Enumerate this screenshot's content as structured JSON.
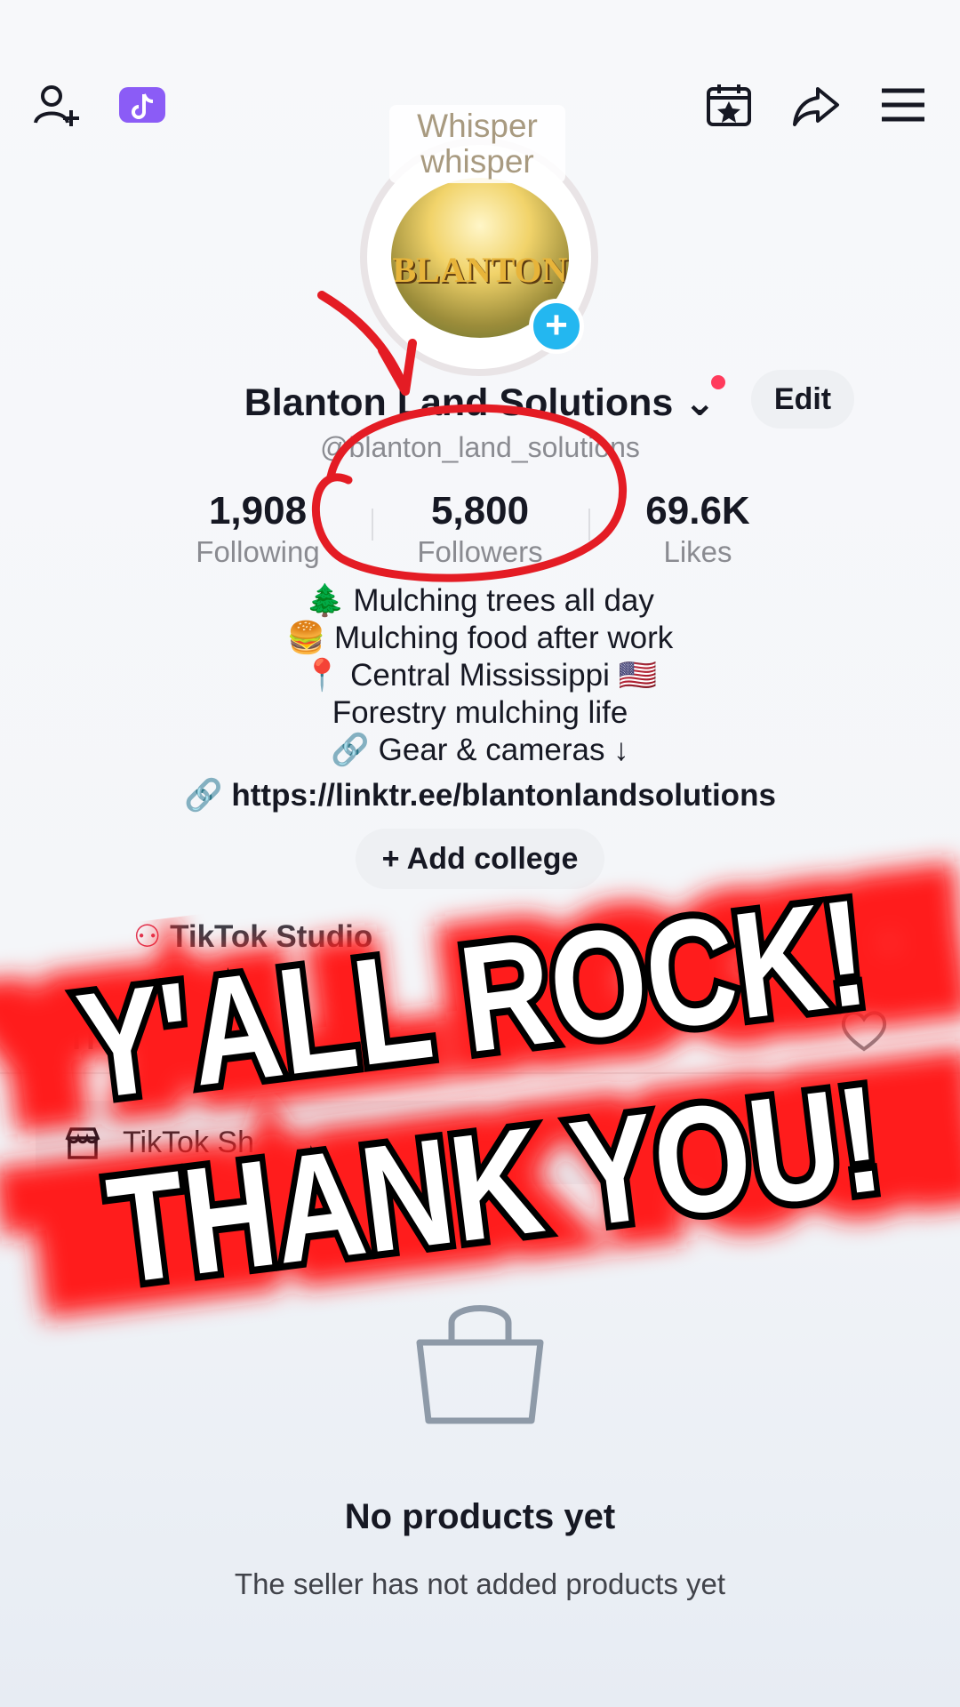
{
  "header": {
    "add_friend_icon": "person-plus",
    "app_badge_icon": "tiktok-purple-badge",
    "calendar_icon": "calendar-star",
    "share_icon": "share-arrow",
    "menu_icon": "hamburger"
  },
  "profile": {
    "note_text": "Whisper whisper",
    "logo_text": "BLANTON",
    "name": "Blanton Land Solutions",
    "edit_label": "Edit",
    "handle": "@blanton_land_solutions",
    "stats": [
      {
        "value": "1,908",
        "label": "Following"
      },
      {
        "value": "5,800",
        "label": "Followers"
      },
      {
        "value": "69.6K",
        "label": "Likes"
      }
    ],
    "bio": [
      "🌲 Mulching trees all day",
      "🍔 Mulching food after work",
      "📍 Central Mississippi 🇺🇸",
      "Forestry mulching life",
      "🔗 Gear & cameras ↓"
    ],
    "link": "https://linktr.ee/blantonlandsolutions",
    "add_college": "Add college"
  },
  "shortcuts": {
    "studio": "TikTok Studio",
    "shop_tail": "hop"
  },
  "shop_card": {
    "label": "TikTok Sh"
  },
  "empty_state": {
    "title": "No products yet",
    "subtitle": "The seller has not added products yet"
  },
  "overlay": {
    "line1": "Y'ALL ROCK!",
    "line2": "THANK YOU!"
  },
  "colors": {
    "accent_red": "#e41c24",
    "badge_blue": "#23b7f0",
    "app_badge": "#8b5cf6"
  }
}
